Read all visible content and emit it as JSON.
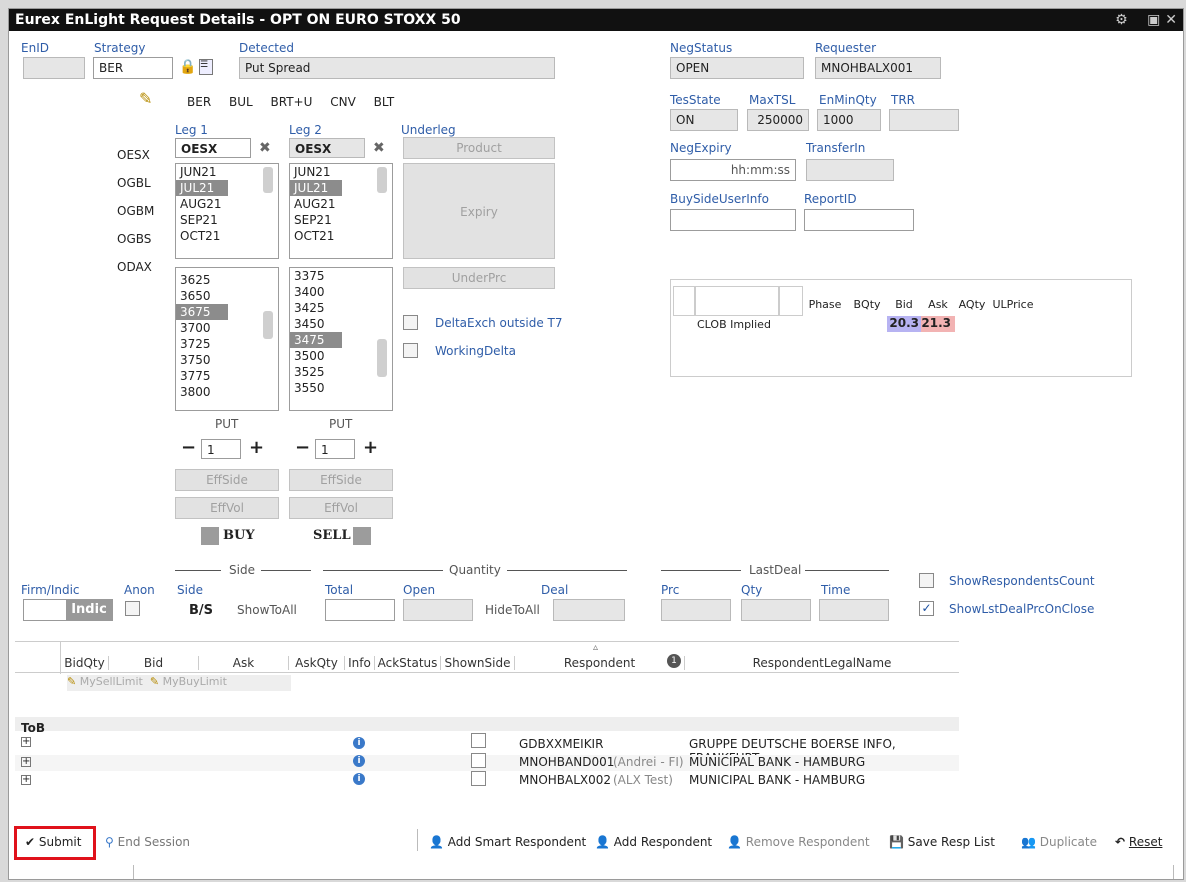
{
  "window": {
    "title": "Eurex EnLight Request Details - OPT ON EURO STOXX 50"
  },
  "header": {
    "enid_label": "EnID",
    "strategy_label": "Strategy",
    "strategy_value": "BER",
    "detected_label": "Detected",
    "detected_value": "Put Spread",
    "negstatus_label": "NegStatus",
    "negstatus_value": "OPEN",
    "requester_label": "Requester",
    "requester_value": "MNOHBALX001",
    "tesstate_label": "TesState",
    "tesstate_value": "ON",
    "maxtsl_label": "MaxTSL",
    "maxtsl_value": "250000",
    "enminqty_label": "EnMinQty",
    "enminqty_value": "1000",
    "trr_label": "TRR",
    "negexpiry_label": "NegExpiry",
    "negexpiry_placeholder": "hh:mm:ss",
    "transferin_label": "TransferIn",
    "buysideuserinfo_label": "BuySideUserInfo",
    "reportid_label": "ReportID"
  },
  "strategy_buttons": [
    "BER",
    "BUL",
    "BRT+U",
    "CNV",
    "BLT"
  ],
  "products": [
    "OESX",
    "OGBL",
    "OGBM",
    "OGBS",
    "ODAX"
  ],
  "legs": [
    {
      "label": "Leg 1",
      "product": "OESX",
      "expiries": [
        "JUN21",
        "JUL21",
        "AUG21",
        "SEP21",
        "OCT21"
      ],
      "selected_expiry": "JUL21",
      "strikes": [
        "3625",
        "3650",
        "3675",
        "3700",
        "3725",
        "3750",
        "3775",
        "3800"
      ],
      "selected_strike": "3675",
      "type": "PUT",
      "ratio": "1",
      "effside": "EffSide",
      "effvol": "EffVol",
      "side": "BUY"
    },
    {
      "label": "Leg 2",
      "product": "OESX",
      "expiries": [
        "JUN21",
        "JUL21",
        "AUG21",
        "SEP21",
        "OCT21"
      ],
      "selected_expiry": "JUL21",
      "strikes": [
        "3375",
        "3400",
        "3425",
        "3450",
        "3475",
        "3500",
        "3525",
        "3550"
      ],
      "selected_strike": "3475",
      "type": "PUT",
      "ratio": "1",
      "effside": "EffSide",
      "effvol": "EffVol",
      "side": "SELL"
    }
  ],
  "underleg": {
    "label": "Underleg",
    "product_btn": "Product",
    "expiry_btn": "Expiry",
    "underprc_btn": "UnderPrc",
    "delta_label": "DeltaExch outside T7",
    "working_delta_label": "WorkingDelta"
  },
  "clob": {
    "headers": [
      "Phase",
      "BQty",
      "Bid",
      "Ask",
      "AQty",
      "ULPrice"
    ],
    "row_label": "CLOB Implied",
    "bid": "20.3",
    "ask": "21.3",
    "bid_color": "#b7b3f2",
    "ask_color": "#f2b3b3"
  },
  "sides": {
    "side_group": "Side",
    "quantity_group": "Quantity",
    "lastdeal_group": "LastDeal",
    "firm_label": "Firm/Indic",
    "firm_value": "Indic",
    "anon_label": "Anon",
    "side_label": "Side",
    "side_value": "B/S",
    "showtoall": "ShowToAll",
    "total_label": "Total",
    "open_label": "Open",
    "hidetoall": "HideToAll",
    "deal_label": "Deal",
    "prc_label": "Prc",
    "qty_label": "Qty",
    "time_label": "Time",
    "show_respondents": "ShowRespondentsCount",
    "show_lastdeal": "ShowLstDealPrcOnClose"
  },
  "resp_table": {
    "headers": [
      "BidQty",
      "Bid",
      "Ask",
      "AskQty",
      "Info",
      "AckStatus",
      "ShownSide",
      "Respondent",
      "RespondentLegalName"
    ],
    "my_sell_limit": "MySellLimit",
    "my_buy_limit": "MyBuyLimit",
    "badge": "1",
    "tob": "ToB",
    "rows": [
      {
        "respondent": "GDBXXMEIKIR",
        "alias": "",
        "legal": "GRUPPE DEUTSCHE BOERSE INFO, FRANKFURT"
      },
      {
        "respondent": "MNOHBAND001",
        "alias": "(Andrei - FI)",
        "legal": "MUNICIPAL BANK - HAMBURG"
      },
      {
        "respondent": "MNOHBALX002",
        "alias": "(ALX Test)",
        "legal": "MUNICIPAL BANK - HAMBURG"
      }
    ]
  },
  "toolbar": {
    "submit": "Submit",
    "end_session": "End Session",
    "add_smart": "Add Smart Respondent",
    "add_respondent": "Add Respondent",
    "remove_respondent": "Remove Respondent",
    "save_resp_list": "Save Resp List",
    "duplicate": "Duplicate",
    "reset": "Reset",
    "accent_red": "#e0121b"
  }
}
